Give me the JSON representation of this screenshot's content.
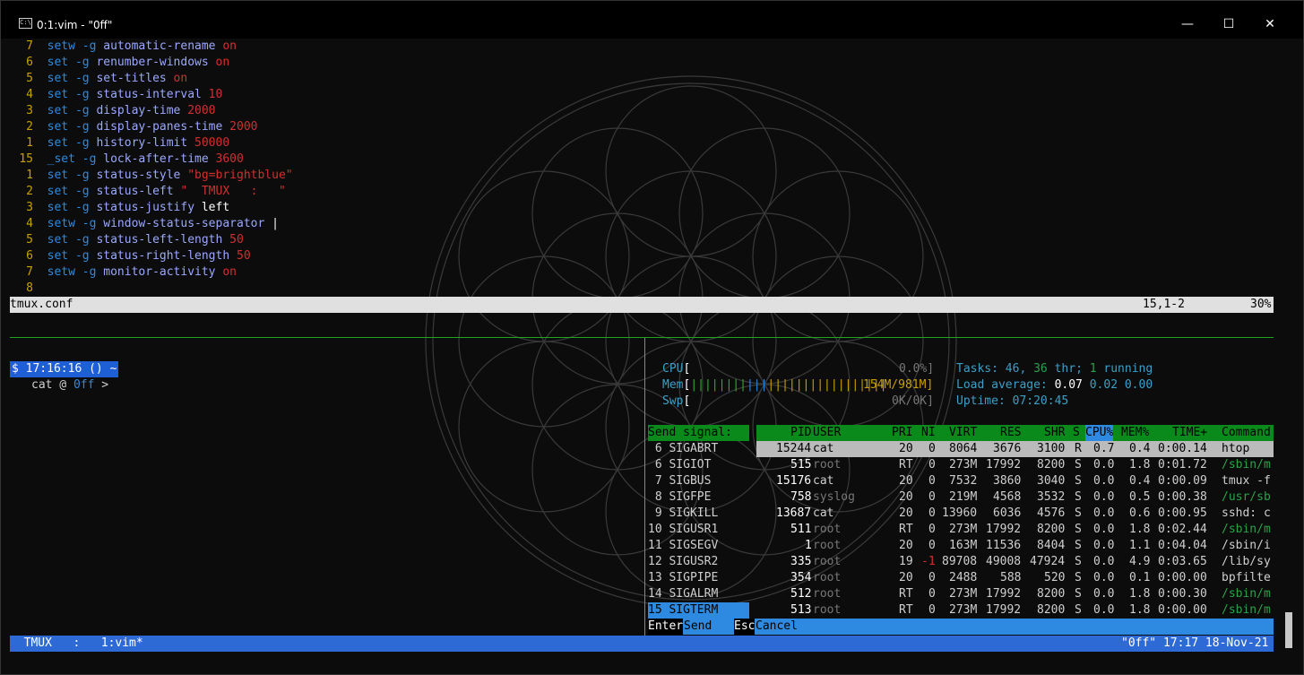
{
  "window": {
    "title": "0:1:vim - \"0ff\"",
    "minimize": "—",
    "maximize": "☐",
    "close": "✕"
  },
  "vim": {
    "lines": [
      {
        "n": "7",
        "cmd": "setw",
        "rest": " -g ",
        "opt": "automatic-rename",
        "val": " on"
      },
      {
        "n": "6",
        "cmd": "set",
        "rest": " -g ",
        "opt": "renumber-windows",
        "val": " on"
      },
      {
        "n": "5",
        "cmd": "set",
        "rest": " -g ",
        "opt": "set-titles",
        "val": " on"
      },
      {
        "n": "4",
        "cmd": "set",
        "rest": " -g ",
        "opt": "status-interval",
        "val": " 10"
      },
      {
        "n": "3",
        "cmd": "set",
        "rest": " -g ",
        "opt": "display-time",
        "val": " 2000"
      },
      {
        "n": "2",
        "cmd": "set",
        "rest": " -g ",
        "opt": "display-panes-time",
        "val": " 2000"
      },
      {
        "n": "1",
        "cmd": "set",
        "rest": " -g ",
        "opt": "history-limit",
        "val": " 50000"
      },
      {
        "n": "15",
        "cmd": "_set",
        "rest": " -g ",
        "opt": "lock-after-time",
        "val": " 3600"
      },
      {
        "n": "1",
        "cmd": "set",
        "rest": " -g ",
        "opt": "status-style",
        "val": " \"bg=brightblue\""
      },
      {
        "n": "2",
        "cmd": "set",
        "rest": " -g ",
        "opt": "status-left",
        "val": " \"  TMUX   :   \""
      },
      {
        "n": "3",
        "cmd": "set",
        "rest": " -g ",
        "opt": "status-justify",
        "val": " left"
      },
      {
        "n": "4",
        "cmd": "setw",
        "rest": " -g ",
        "opt": "window-status-separator",
        "val": " |"
      },
      {
        "n": "5",
        "cmd": "set",
        "rest": " -g ",
        "opt": "status-left-length",
        "val": " 50"
      },
      {
        "n": "6",
        "cmd": "set",
        "rest": " -g ",
        "opt": "status-right-length",
        "val": " 50"
      },
      {
        "n": "7",
        "cmd": "setw",
        "rest": " -g ",
        "opt": "monitor-activity",
        "val": " on"
      },
      {
        "n": "8",
        "cmd": "",
        "rest": "",
        "opt": "",
        "val": ""
      }
    ],
    "status_file": "tmux.conf",
    "status_pos": "15,1-2",
    "status_pct": "30%"
  },
  "shell": {
    "prompt": "$ 17:16:16 () ~",
    "cmd": "cat @ ",
    "arg": "0ff",
    "tail": " >"
  },
  "htop": {
    "cpu_label": "CPU",
    "cpu_val": "0.0%]",
    "mem_label": "Mem",
    "mem_val": "154M/981M]",
    "swp_label": "Swp",
    "swp_val": "0K/0K]",
    "tasks": "Tasks: ",
    "tasks_n": "46",
    "thr_n": "36",
    "thr": " thr; ",
    "run_n": "1",
    "run": " running",
    "load_label": "Load average: ",
    "load1": "0.07",
    "load5": "0.02",
    "load15": "0.00",
    "uptime_label": "Uptime: ",
    "uptime": "07:20:45",
    "send_signal": "Send signal:",
    "columns": [
      "PID",
      "USER",
      "PRI",
      "NI",
      "VIRT",
      "RES",
      "SHR",
      "S",
      "CPU%",
      "MEM%",
      "TIME+",
      "Command"
    ],
    "signals": [
      "6 SIGABRT",
      "6 SIGIOT",
      "7 SIGBUS",
      "8 SIGFPE",
      "9 SIGKILL",
      "10 SIGUSR1",
      "11 SIGSEGV",
      "12 SIGUSR2",
      "13 SIGPIPE",
      "14 SIGALRM",
      "15 SIGTERM"
    ],
    "procs": [
      [
        "15244",
        "cat",
        "20",
        "0",
        "8064",
        "3676",
        "3100",
        "R",
        "0.7",
        "0.4",
        "0:00.14",
        "htop"
      ],
      [
        "515",
        "root",
        "RT",
        "0",
        "273M",
        "17992",
        "8200",
        "S",
        "0.0",
        "1.8",
        "0:01.72",
        "/sbin/m"
      ],
      [
        "15176",
        "cat",
        "20",
        "0",
        "7532",
        "3860",
        "3040",
        "S",
        "0.0",
        "0.4",
        "0:00.09",
        "tmux -f"
      ],
      [
        "758",
        "syslog",
        "20",
        "0",
        "219M",
        "4568",
        "3532",
        "S",
        "0.0",
        "0.5",
        "0:00.38",
        "/usr/sb"
      ],
      [
        "13687",
        "cat",
        "20",
        "0",
        "13960",
        "6036",
        "4576",
        "S",
        "0.0",
        "0.6",
        "0:00.95",
        "sshd: c"
      ],
      [
        "511",
        "root",
        "RT",
        "0",
        "273M",
        "17992",
        "8200",
        "S",
        "0.0",
        "1.8",
        "0:02.44",
        "/sbin/m"
      ],
      [
        "1",
        "root",
        "20",
        "0",
        "163M",
        "11536",
        "8404",
        "S",
        "0.0",
        "1.1",
        "0:04.04",
        "/sbin/i"
      ],
      [
        "335",
        "root",
        "19",
        "-1",
        "89708",
        "49008",
        "47924",
        "S",
        "0.0",
        "4.9",
        "0:03.65",
        "/lib/sy"
      ],
      [
        "354",
        "root",
        "20",
        "0",
        "2488",
        "588",
        "520",
        "S",
        "0.0",
        "0.1",
        "0:00.00",
        "bpfilte"
      ],
      [
        "512",
        "root",
        "RT",
        "0",
        "273M",
        "17992",
        "8200",
        "S",
        "0.0",
        "1.8",
        "0:00.30",
        "/sbin/m"
      ],
      [
        "513",
        "root",
        "RT",
        "0",
        "273M",
        "17992",
        "8200",
        "S",
        "0.0",
        "1.8",
        "0:00.00",
        "/sbin/m"
      ]
    ],
    "foot_enter": "Enter",
    "foot_send": "Send",
    "foot_esc": "Esc",
    "foot_cancel": "Cancel"
  },
  "tmux": {
    "left": "  TMUX   :   1:vim*",
    "right": "\"0ff\" 17:17 18-Nov-21"
  }
}
